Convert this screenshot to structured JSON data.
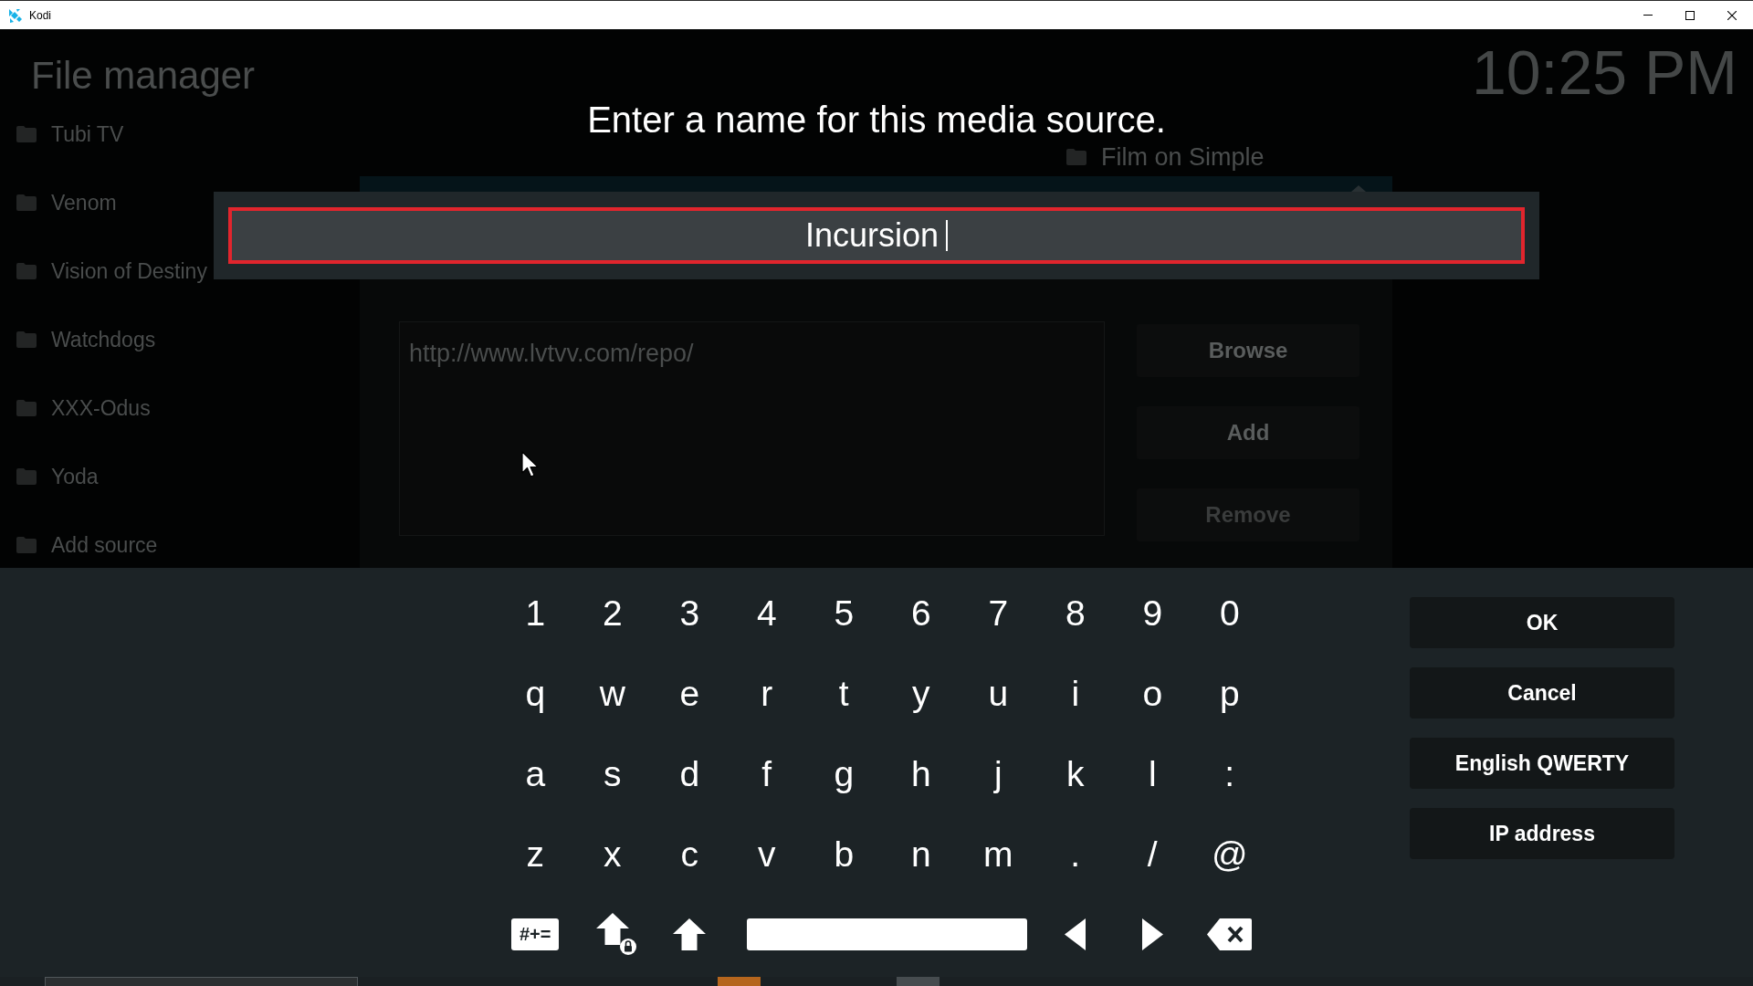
{
  "window": {
    "title": "Kodi"
  },
  "file_manager": {
    "heading": "File manager",
    "clock": "10:25 PM",
    "sources": [
      "Tubi TV",
      "Venom",
      "Vision of Destiny",
      "Watchdogs",
      "XXX-Odus",
      "Yoda",
      "Add source"
    ],
    "add_source_dialog": {
      "list_item": "Film on Simple",
      "path": "http://www.lvtvv.com/repo/",
      "buttons": [
        {
          "label": "Browse",
          "disabled": false
        },
        {
          "label": "Add",
          "disabled": false
        },
        {
          "label": "Remove",
          "disabled": true
        }
      ]
    }
  },
  "keyboard_dialog": {
    "heading": "Enter a name for this media source.",
    "value": "Incursion",
    "key_rows": [
      [
        "1",
        "2",
        "3",
        "4",
        "5",
        "6",
        "7",
        "8",
        "9",
        "0"
      ],
      [
        "q",
        "w",
        "e",
        "r",
        "t",
        "y",
        "u",
        "i",
        "o",
        "p"
      ],
      [
        "a",
        "s",
        "d",
        "f",
        "g",
        "h",
        "j",
        "k",
        "l",
        ":"
      ],
      [
        "z",
        "x",
        "c",
        "v",
        "b",
        "n",
        "m",
        ".",
        "/",
        "@"
      ]
    ],
    "special_keys": [
      {
        "kind": "symbols",
        "label": "#+="
      },
      {
        "kind": "caps_lock"
      },
      {
        "kind": "shift"
      },
      {
        "kind": "space"
      },
      {
        "kind": "left"
      },
      {
        "kind": "right"
      },
      {
        "kind": "backspace"
      }
    ],
    "buttons": [
      "OK",
      "Cancel",
      "English QWERTY",
      "IP address"
    ]
  }
}
